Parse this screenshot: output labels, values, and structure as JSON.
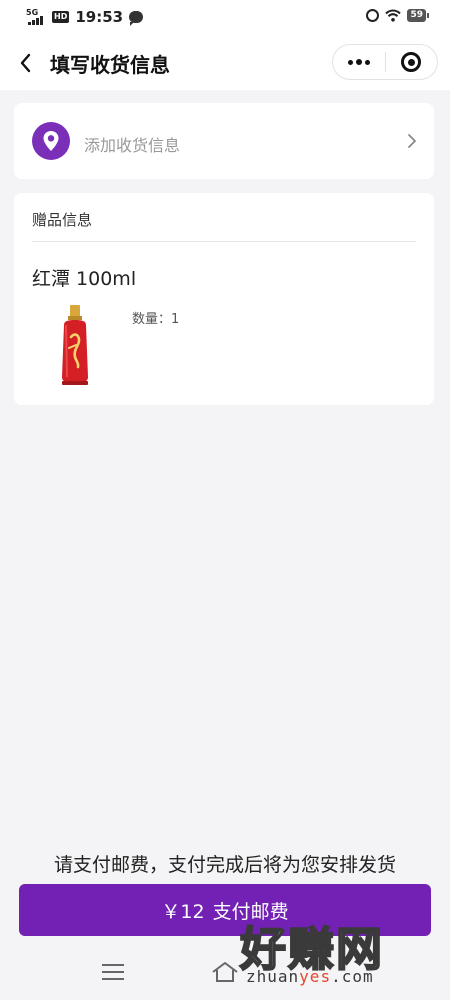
{
  "status_bar": {
    "network": "5G",
    "hd": "HD",
    "time": "19:53",
    "battery": "59"
  },
  "nav": {
    "title": "填写收货信息"
  },
  "address": {
    "placeholder": "添加收货信息"
  },
  "gift": {
    "header": "赠品信息",
    "product_name": "红潭 100ml",
    "quantity_label": "数量：",
    "quantity_value": "1"
  },
  "footer": {
    "notice": "请支付邮费，支付完成后将为您安排发货",
    "price": "￥12",
    "pay_label": "支付邮费"
  },
  "watermark": {
    "main": "好赚网",
    "sub_prefix": "zhuan",
    "sub_highlight": "yes",
    "sub_suffix": ".com"
  },
  "colors": {
    "accent": "#7320b4",
    "background": "#f4f4f6",
    "card": "#ffffff"
  },
  "icons": {
    "back": "chevron-left-icon",
    "more": "more-dots-icon",
    "close": "target-close-icon",
    "location": "location-pin-icon",
    "arrow": "chevron-right-icon",
    "menu": "menu-icon",
    "home": "home-icon"
  }
}
